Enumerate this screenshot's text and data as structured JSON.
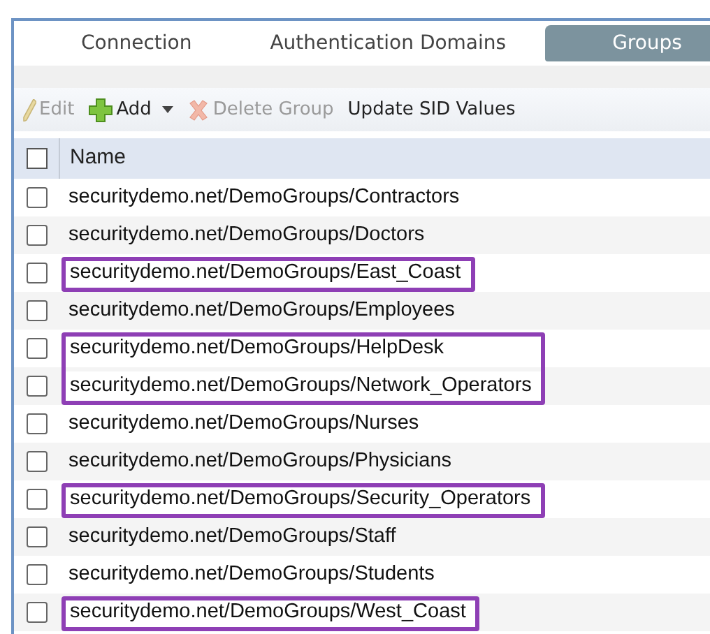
{
  "tabs": [
    {
      "label": "Connection",
      "selected": false
    },
    {
      "label": "Authentication Domains",
      "selected": false
    },
    {
      "label": "Groups",
      "selected": true
    }
  ],
  "toolbar": [
    {
      "kind": "edit",
      "label": "Edit",
      "disabled": true
    },
    {
      "kind": "add",
      "label": "Add",
      "disabled": false
    },
    {
      "kind": "delete",
      "label": "Delete Group",
      "disabled": true
    },
    {
      "kind": "plain",
      "label": "Update SID Values",
      "disabled": false
    }
  ],
  "table": {
    "columns": [
      "Name"
    ],
    "header_checked": false,
    "rows": [
      {
        "name": "securitydemo.net/DemoGroups/Contractors",
        "checked": false,
        "highlighted": false
      },
      {
        "name": "securitydemo.net/DemoGroups/Doctors",
        "checked": false,
        "highlighted": false
      },
      {
        "name": "securitydemo.net/DemoGroups/East_Coast",
        "checked": false,
        "highlighted": true
      },
      {
        "name": "securitydemo.net/DemoGroups/Employees",
        "checked": false,
        "highlighted": false
      },
      {
        "name": "securitydemo.net/DemoGroups/HelpDesk",
        "checked": false,
        "highlighted": true
      },
      {
        "name": "securitydemo.net/DemoGroups/Network_Operators",
        "checked": false,
        "highlighted": true
      },
      {
        "name": "securitydemo.net/DemoGroups/Nurses",
        "checked": false,
        "highlighted": false
      },
      {
        "name": "securitydemo.net/DemoGroups/Physicians",
        "checked": false,
        "highlighted": false
      },
      {
        "name": "securitydemo.net/DemoGroups/Security_Operators",
        "checked": false,
        "highlighted": true
      },
      {
        "name": "securitydemo.net/DemoGroups/Staff",
        "checked": false,
        "highlighted": false
      },
      {
        "name": "securitydemo.net/DemoGroups/Students",
        "checked": false,
        "highlighted": false
      },
      {
        "name": "securitydemo.net/DemoGroups/West_Coast",
        "checked": false,
        "highlighted": true
      }
    ]
  }
}
